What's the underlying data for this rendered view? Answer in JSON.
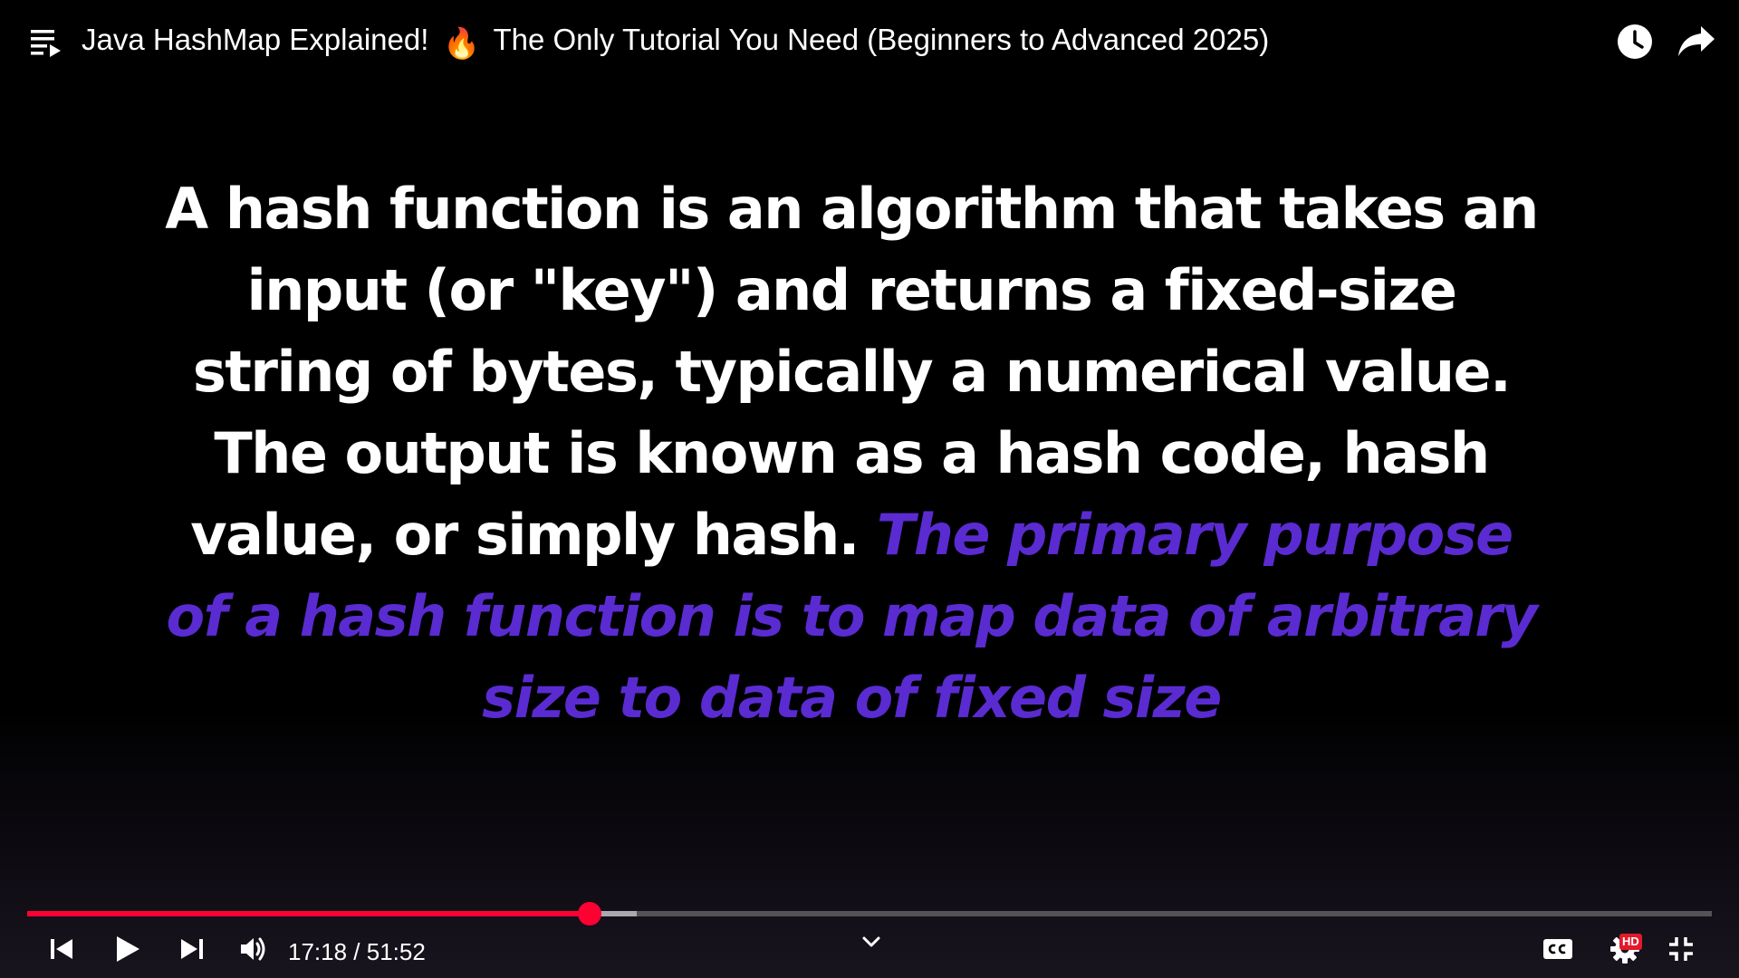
{
  "header": {
    "title_part1": "Java HashMap Explained!",
    "title_emoji": "🔥",
    "title_part2": "The Only Tutorial You Need (Beginners to Advanced 2025)",
    "icons": [
      "playlist-icon",
      "watch-later-icon",
      "share-icon"
    ]
  },
  "slide": {
    "body": "A hash function is an algorithm that takes an input (or \"key\") and returns a fixed-size string of bytes, typically a numerical value. The output is known as a hash code, hash value, or simply hash. ",
    "highlight": "The primary purpose of a hash function is to map data of arbitrary size to data of fixed size",
    "highlight_color": "#5a2bd1"
  },
  "player": {
    "current_time": "17:18",
    "duration": "51:52",
    "time_label": "17:18 / 51:52",
    "progress_fraction": 0.3337,
    "buffered_fraction": 0.362,
    "quality_badge": "HD",
    "accent_color": "#ff0033",
    "icons": [
      "previous-icon",
      "play-icon",
      "next-icon",
      "volume-icon",
      "chevron-down-icon",
      "closed-captions-icon",
      "gear-icon",
      "exit-fullscreen-icon"
    ]
  }
}
